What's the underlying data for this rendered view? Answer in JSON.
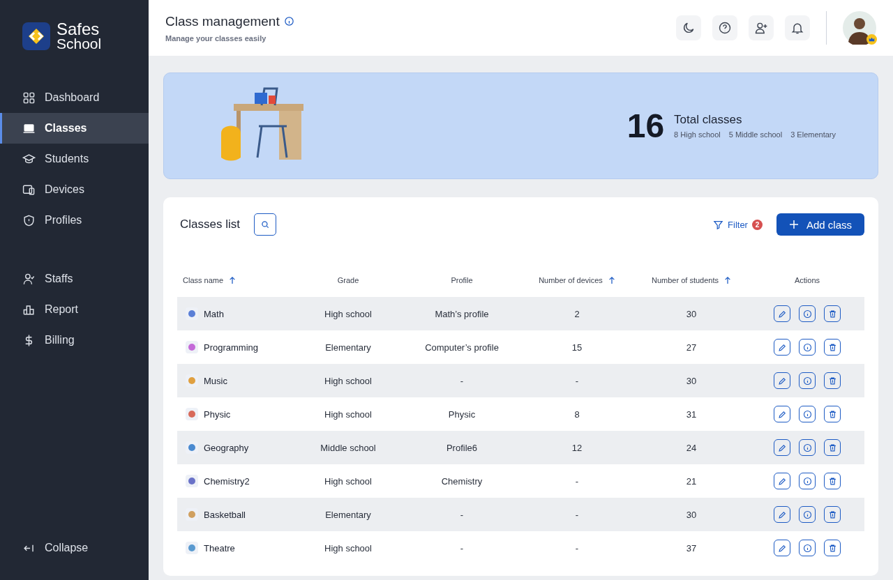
{
  "brand": {
    "line1": "Safes",
    "line2": "School"
  },
  "sidebar": {
    "groups": [
      [
        {
          "label": "Dashboard",
          "selected": false
        },
        {
          "label": "Classes",
          "selected": true
        },
        {
          "label": "Students",
          "selected": false
        },
        {
          "label": "Devices",
          "selected": false
        },
        {
          "label": "Profiles",
          "selected": false
        }
      ],
      [
        {
          "label": "Staffs",
          "selected": false
        },
        {
          "label": "Report",
          "selected": false
        },
        {
          "label": "Billing",
          "selected": false
        }
      ]
    ],
    "collapse": "Collapse"
  },
  "header": {
    "title": "Class management",
    "subtitle": "Manage your classes easily"
  },
  "summary": {
    "count": "16",
    "label": "Total classes",
    "breakdown": [
      "8 High school",
      "5 Middle school",
      "3 Elementary"
    ]
  },
  "list": {
    "title": "Classes list",
    "filter": "Filter",
    "filter_count": "2",
    "add": "Add class",
    "columns": [
      {
        "label": "Class name",
        "sortable": true
      },
      {
        "label": "Grade",
        "sortable": false
      },
      {
        "label": "Profile",
        "sortable": false
      },
      {
        "label": "Number of devices",
        "sortable": true
      },
      {
        "label": "Number of students",
        "sortable": true
      },
      {
        "label": "Actions",
        "sortable": false
      }
    ],
    "rows": [
      {
        "name": "Math",
        "grade": "High school",
        "profile": "Math’s profile",
        "devices": "2",
        "students": "30"
      },
      {
        "name": "Programming",
        "grade": "Elementary",
        "profile": "Computer’s profile",
        "devices": "15",
        "students": "27"
      },
      {
        "name": "Music",
        "grade": "High school",
        "profile": "-",
        "devices": "-",
        "students": "30"
      },
      {
        "name": "Physic",
        "grade": "High school",
        "profile": "Physic",
        "devices": "8",
        "students": "31"
      },
      {
        "name": "Geography",
        "grade": "Middle school",
        "profile": "Profile6",
        "devices": "12",
        "students": "24"
      },
      {
        "name": "Chemistry2",
        "grade": "High school",
        "profile": "Chemistry",
        "devices": "-",
        "students": "21"
      },
      {
        "name": "Basketball",
        "grade": "Elementary",
        "profile": "-",
        "devices": "-",
        "students": "30"
      },
      {
        "name": "Theatre",
        "grade": "High school",
        "profile": "-",
        "devices": "-",
        "students": "37"
      }
    ]
  }
}
